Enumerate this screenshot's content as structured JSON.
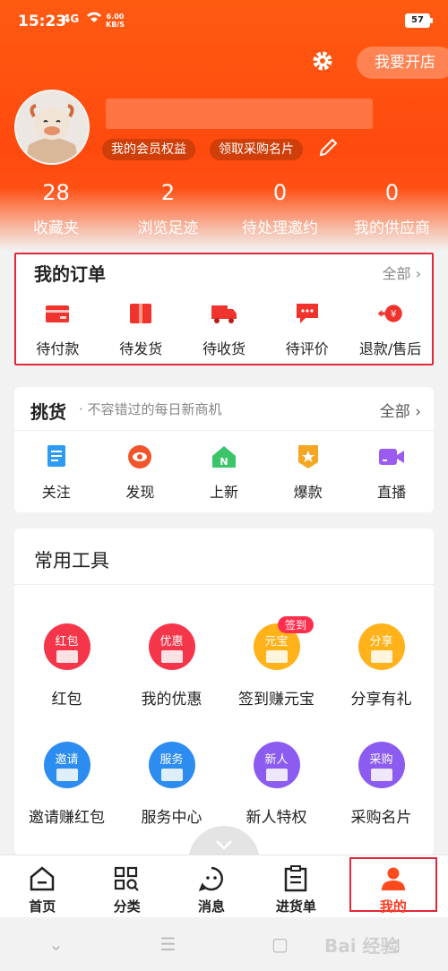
{
  "status": {
    "time": "15:23",
    "network": "4G",
    "speed_value": "6.00",
    "speed_unit": "KB/S",
    "battery": "57"
  },
  "header": {
    "open_shop_label": "我要开店",
    "tags": [
      "我的会员权益",
      "领取采购名片"
    ]
  },
  "stats": [
    {
      "value": "28",
      "label": "收藏夹"
    },
    {
      "value": "2",
      "label": "浏览足迹"
    },
    {
      "value": "0",
      "label": "待处理邀约"
    },
    {
      "value": "0",
      "label": "我的供应商"
    }
  ],
  "orders": {
    "title": "我的订单",
    "all_label": "全部",
    "items": [
      {
        "label": "待付款",
        "icon": "wallet-card-icon"
      },
      {
        "label": "待发货",
        "icon": "package-icon"
      },
      {
        "label": "待收货",
        "icon": "truck-icon"
      },
      {
        "label": "待评价",
        "icon": "comment-icon"
      },
      {
        "label": "退款/售后",
        "icon": "refund-icon"
      }
    ]
  },
  "pick": {
    "title": "挑货",
    "subtitle": "· 不容错过的每日新商机",
    "all_label": "全部",
    "items": [
      {
        "label": "关注",
        "icon": "follow-doc-icon"
      },
      {
        "label": "发现",
        "icon": "eye-icon"
      },
      {
        "label": "上新",
        "icon": "new-house-icon"
      },
      {
        "label": "爆款",
        "icon": "star-badge-icon"
      },
      {
        "label": "直播",
        "icon": "video-camera-icon"
      }
    ]
  },
  "tools": {
    "title": "常用工具",
    "items": [
      {
        "label": "红包",
        "circle_text": "红包",
        "color": "#f5364a"
      },
      {
        "label": "我的优惠",
        "circle_text": "优惠",
        "color": "#f5364a"
      },
      {
        "label": "签到赚元宝",
        "circle_text": "元宝",
        "color": "#ffb21a",
        "badge": "签到"
      },
      {
        "label": "分享有礼",
        "circle_text": "分享",
        "color": "#ffb21a"
      },
      {
        "label": "邀请赚红包",
        "circle_text": "邀请",
        "color": "#2d8cf0"
      },
      {
        "label": "服务中心",
        "circle_text": "服务",
        "color": "#2d8cf0"
      },
      {
        "label": "新人特权",
        "circle_text": "新人",
        "color": "#8c5cf0"
      },
      {
        "label": "采购名片",
        "circle_text": "采购",
        "color": "#8c5cf0"
      }
    ]
  },
  "tabbar": [
    {
      "label": "首页"
    },
    {
      "label": "分类"
    },
    {
      "label": "消息"
    },
    {
      "label": "进货单"
    },
    {
      "label": "我的"
    }
  ],
  "watermark": "Bai 经验",
  "colors": {
    "brand": "#ff4a0e",
    "highlight_box": "#e0283a"
  }
}
